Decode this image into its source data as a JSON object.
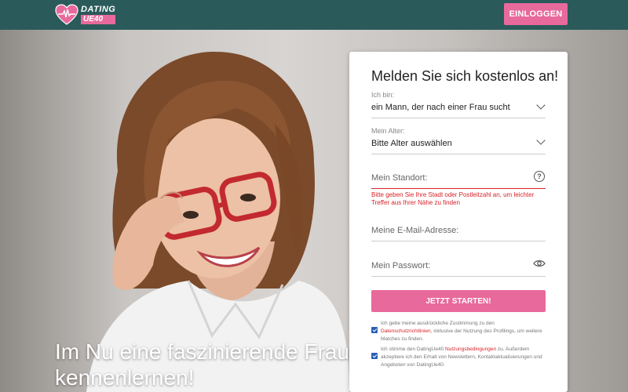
{
  "header": {
    "logo_line1": "DATING",
    "logo_line2": "UE40",
    "login_label": "EINLOGGEN"
  },
  "hero": {
    "headline": "Im Nu eine faszinierende Frau kennenlernen!"
  },
  "form": {
    "title": "Melden Sie sich kostenlos an!",
    "gender": {
      "label": "Ich bin:",
      "value": "ein Mann, der nach einer Frau sucht"
    },
    "age": {
      "label": "Mein Alter:",
      "value": "Bitte Alter auswählen"
    },
    "location": {
      "placeholder": "Mein Standort:",
      "error": "Bitte geben Sie Ihre Stadt oder Postleitzahl an, um leichter Treffer aus Ihrer Nähe zu finden"
    },
    "email": {
      "placeholder": "Meine E-Mail-Adresse:"
    },
    "password": {
      "placeholder": "Mein Passwort:"
    },
    "submit_label": "JETZT STARTEN!",
    "consent1": {
      "before": "Ich gebe meine ausdrückliche Zustimmung zu den ",
      "link": "Datenschutzrichtlinien",
      "after": ", inklusive der Nutzung des Profilings, um weitere Matches zu finden."
    },
    "consent2": {
      "before": "Ich stimme den DatingUe40 ",
      "link": "Nutzungsbedingungen",
      "after": " zu. Außerdem akzeptiere ich den Erhalt von Newslettern, Kontaktaktualisierungen und Angeboten von DatingUe40."
    }
  },
  "colors": {
    "header_bg": "#2a5a5a",
    "accent": "#e8699b",
    "error": "#d8232a"
  },
  "icons": {
    "logo": "heart-pulse-icon",
    "select": "chevron-down-icon",
    "help": "question-circle-icon",
    "password": "eye-icon"
  }
}
